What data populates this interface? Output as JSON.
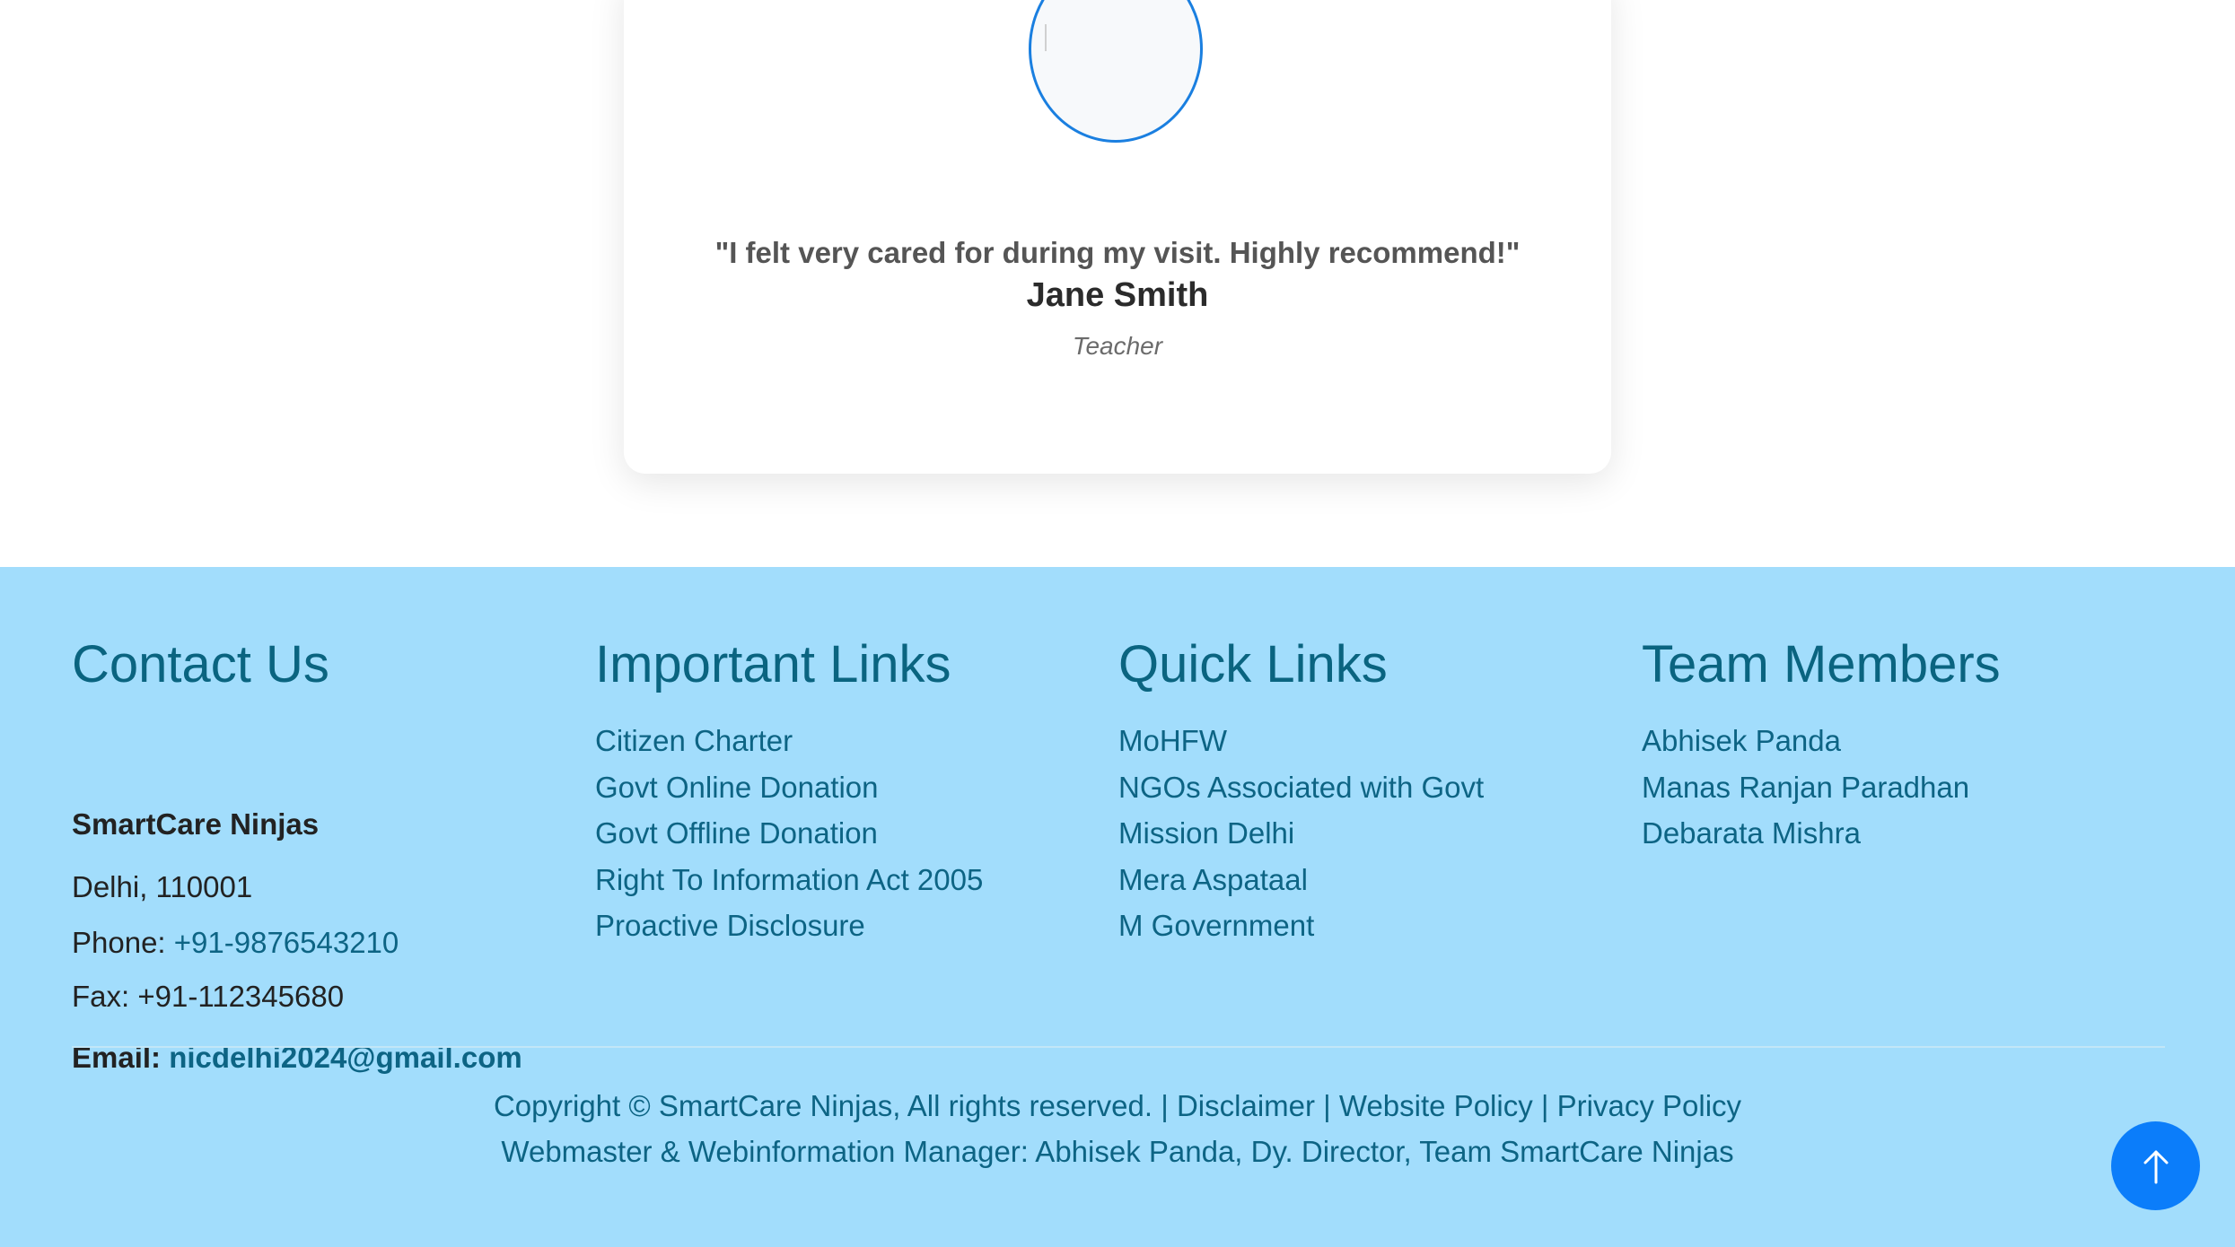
{
  "testimonial": {
    "quote": "\"I felt very cared for during my visit. Highly recommend!\"",
    "name": "Jane Smith",
    "role": "Teacher",
    "avatar_icon": "broken-image-icon"
  },
  "footer": {
    "contact": {
      "title": "Contact Us",
      "org": "SmartCare Ninjas",
      "address": "Delhi, 110001",
      "phone_label": "Phone: ",
      "phone": "+91-9876543210",
      "fax": "Fax: +91-112345680",
      "email_label": "Email: ",
      "email": "nicdelhi2024@gmail.com"
    },
    "important_links": {
      "title": "Important Links",
      "items": [
        "Citizen Charter",
        "Govt Online Donation",
        "Govt Offline Donation",
        "Right To Information Act 2005",
        "Proactive Disclosure"
      ]
    },
    "quick_links": {
      "title": "Quick Links",
      "items": [
        "MoHFW",
        "NGOs Associated with Govt",
        "Mission Delhi",
        "Mera Aspataal",
        "M Government"
      ]
    },
    "team": {
      "title": "Team Members",
      "items": [
        "Abhisek Panda",
        "Manas Ranjan Paradhan",
        "Debarata Mishra"
      ]
    },
    "bottom": {
      "copyright": "Copyright © SmartCare Ninjas, All rights reserved.",
      "separator": " | ",
      "disclaimer": "Disclaimer",
      "website_policy": "Website Policy",
      "privacy_policy": "Privacy Policy",
      "webmaster": "Webmaster & Webinformation Manager: Abhisek Panda, Dy. Director, Team SmartCare Ninjas"
    }
  },
  "scroll_top": {
    "icon": "arrow-up-icon"
  },
  "colors": {
    "footer_bg": "#a2ddfc",
    "link": "#0d6484",
    "heading": "#0a6480",
    "accent_blue": "#0b7dfa",
    "avatar_border": "#1a7fe0"
  }
}
